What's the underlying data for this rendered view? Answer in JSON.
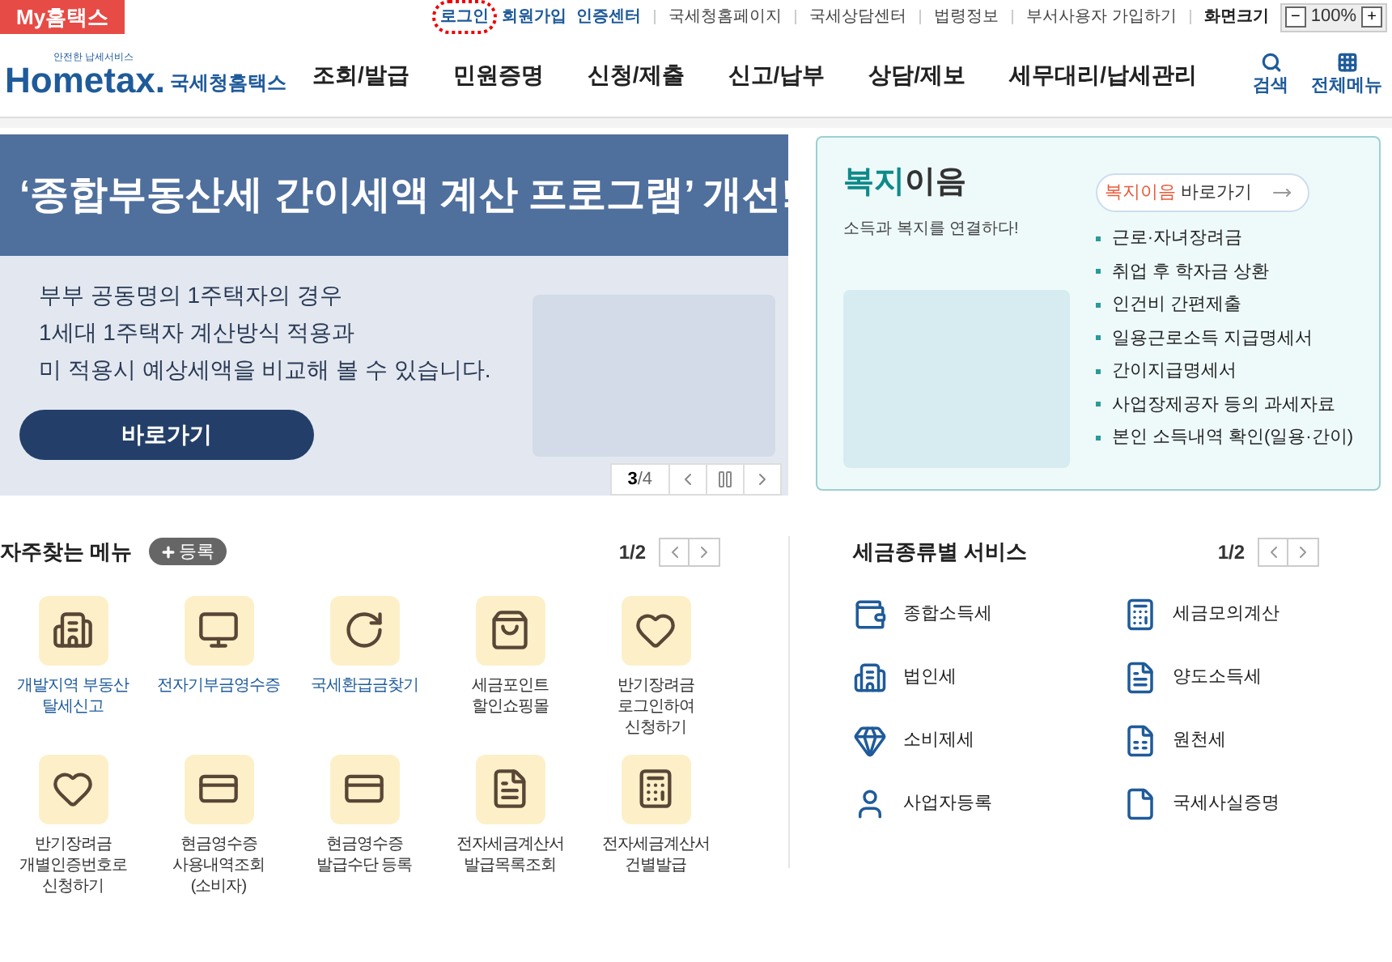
{
  "top_bar": {
    "my_tab": "My홈택스",
    "links": [
      {
        "label": "로그인",
        "highlighted": true,
        "kind": "primary"
      },
      {
        "label": "회원가입",
        "highlighted": false,
        "kind": "primary"
      },
      {
        "label": "인증센터",
        "highlighted": false,
        "kind": "primary"
      },
      {
        "label": "국세청홈페이지",
        "highlighted": false,
        "kind": "plain"
      },
      {
        "label": "국세상담센터",
        "highlighted": false,
        "kind": "plain"
      },
      {
        "label": "법령정보",
        "highlighted": false,
        "kind": "plain"
      },
      {
        "label": "부서사용자 가입하기",
        "highlighted": false,
        "kind": "plain"
      },
      {
        "label": "화면크기",
        "highlighted": false,
        "kind": "bold"
      }
    ],
    "zoom_minus": "−",
    "zoom_value": "100%",
    "zoom_plus": "+"
  },
  "header": {
    "logo_tagline": "안전한 납세서비스",
    "logo_text": "Hometax.",
    "logo_subtitle": "국세청홈택스",
    "nav": [
      "조회/발급",
      "민원증명",
      "신청/제출",
      "신고/납부",
      "상담/제보",
      "세무대리/납세관리"
    ],
    "search": "검색",
    "all_menu": "전체메뉴"
  },
  "banner": {
    "headline": "‘종합부동산세 간이세액 계산 프로그램’ 개선!",
    "body": [
      "부부 공동명의 1주택자의 경우",
      "1세대 1주택자 계산방식 적용과",
      "미 적용시 예상세액을 비교해 볼 수 있습니다."
    ],
    "button": "바로가기",
    "counter_current": "3",
    "counter_total": "/4"
  },
  "welfare": {
    "title_accent": "복지",
    "title_rest": "이음",
    "subtitle": "소득과 복지를 연결하다!",
    "link_accent": "복지이음",
    "link_rest": " 바로가기",
    "items": [
      "근로·자녀장려금",
      "취업 후 학자금 상환",
      "인건비 간편제출",
      "일용근로소득 지급명세서",
      "간이지급명세서",
      "사업장제공자 등의 과세자료",
      "본인 소득내역 확인(일용·간이)"
    ]
  },
  "frequent_menu": {
    "title": "자주찾는 메뉴",
    "add_button": "등록",
    "page": "1/2",
    "items": [
      {
        "label": "개발지역 부동산\n탈세신고",
        "color": "#1f5b9a",
        "kind": "building"
      },
      {
        "label": "전자기부금영수증",
        "color": "#1f5b9a",
        "kind": "monitor"
      },
      {
        "label": "국세환급금찾기",
        "color": "#1f5b9a",
        "kind": "refund"
      },
      {
        "label": "세금포인트\n할인쇼핑몰",
        "color": "#333333",
        "kind": "bag"
      },
      {
        "label": "반기장려금\n로그인하여\n신청하기",
        "color": "#333333",
        "kind": "heart"
      },
      {
        "label": "반기장려금\n개별인증번호로\n신청하기",
        "color": "#333333",
        "kind": "heart"
      },
      {
        "label": "현금영수증\n사용내역조회\n(소비자)",
        "color": "#333333",
        "kind": "card"
      },
      {
        "label": "현금영수증\n발급수단 등록",
        "color": "#333333",
        "kind": "card"
      },
      {
        "label": "전자세금계산서\n발급목록조회",
        "color": "#333333",
        "kind": "doc"
      },
      {
        "label": "전자세금계산서\n건별발급",
        "color": "#333333",
        "kind": "calc"
      }
    ]
  },
  "tax_services": {
    "title": "세금종류별 서비스",
    "page": "1/2",
    "items": [
      {
        "label": "종합소득세",
        "kind": "money"
      },
      {
        "label": "세금모의계산",
        "kind": "calc"
      },
      {
        "label": "법인세",
        "kind": "building"
      },
      {
        "label": "양도소득세",
        "kind": "doc"
      },
      {
        "label": "소비제세",
        "kind": "gem"
      },
      {
        "label": "원천세",
        "kind": "sheet"
      },
      {
        "label": "사업자등록",
        "kind": "person"
      },
      {
        "label": "국세사실증명",
        "kind": "file"
      }
    ]
  }
}
